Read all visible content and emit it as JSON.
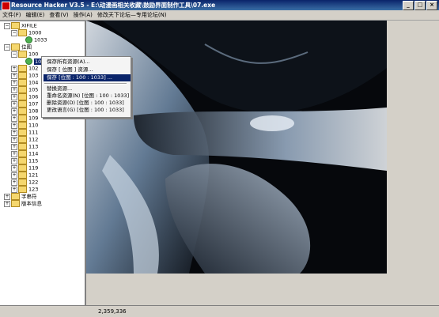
{
  "window": {
    "title": "Resource Hacker V3.5 - E:\\动漫画相关收藏\\鼓励界面制作工具\\07.exe",
    "min_icon": "minimize-icon",
    "max_icon": "maximize-icon",
    "close_icon": "close-icon"
  },
  "menubar": [
    "文件(F)",
    "编辑(E)",
    "查看(V)",
    "操作(A)",
    "修改天下论坛—专用论坛(N)"
  ],
  "tree": [
    {
      "label": "XIFILE",
      "expander": "−",
      "icon": "folder-icon"
    },
    {
      "label": "1000",
      "expander": "−",
      "icon": "folder-icon"
    },
    {
      "label": "1033",
      "expander": "",
      "icon": "gear-icon"
    },
    {
      "label": "位图",
      "expander": "−",
      "icon": "folder-icon"
    },
    {
      "label": "100",
      "expander": "−",
      "icon": "folder-icon"
    },
    {
      "label": "1033",
      "expander": "",
      "icon": "gear-icon",
      "selected": true
    },
    {
      "label": "102",
      "expander": "+",
      "icon": "folder-icon"
    },
    {
      "label": "103",
      "expander": "+",
      "icon": "folder-icon"
    },
    {
      "label": "104",
      "expander": "+",
      "icon": "folder-icon"
    },
    {
      "label": "105",
      "expander": "+",
      "icon": "folder-icon"
    },
    {
      "label": "106",
      "expander": "+",
      "icon": "folder-icon"
    },
    {
      "label": "107",
      "expander": "+",
      "icon": "folder-icon"
    },
    {
      "label": "108",
      "expander": "+",
      "icon": "folder-icon"
    },
    {
      "label": "109",
      "expander": "+",
      "icon": "folder-icon"
    },
    {
      "label": "110",
      "expander": "+",
      "icon": "folder-icon"
    },
    {
      "label": "111",
      "expander": "+",
      "icon": "folder-icon"
    },
    {
      "label": "112",
      "expander": "+",
      "icon": "folder-icon"
    },
    {
      "label": "113",
      "expander": "+",
      "icon": "folder-icon"
    },
    {
      "label": "114",
      "expander": "+",
      "icon": "folder-icon"
    },
    {
      "label": "115",
      "expander": "+",
      "icon": "folder-icon"
    },
    {
      "label": "119",
      "expander": "+",
      "icon": "folder-icon"
    },
    {
      "label": "121",
      "expander": "+",
      "icon": "folder-icon"
    },
    {
      "label": "122",
      "expander": "+",
      "icon": "folder-icon"
    },
    {
      "label": "123",
      "expander": "+",
      "icon": "folder-icon"
    },
    {
      "label": "字串符",
      "expander": "+",
      "icon": "folder-icon"
    },
    {
      "label": "版本信息",
      "expander": "+",
      "icon": "folder-icon"
    }
  ],
  "context_menu": [
    {
      "label": "保存所有资源(A)...",
      "highlighted": false
    },
    {
      "label": "保存 [ 位图 ] 资源...",
      "highlighted": false
    },
    {
      "label": "保存 [位图 : 100 : 1033] ...",
      "highlighted": true
    },
    {
      "label": "替换资源...",
      "highlighted": false
    },
    {
      "label": "重命名资源(N) [位图 : 100 : 1033]",
      "highlighted": false
    },
    {
      "label": "删除资源(D) [位图 : 100 : 1033]",
      "highlighted": false
    },
    {
      "label": "更改语言(G) [位图 : 100 : 1033]",
      "highlighted": false
    }
  ],
  "status": {
    "coords": "2,359,336"
  },
  "colors": {
    "titlebar": "#0a246a",
    "selection": "#0a246a",
    "window_bg": "#d4d0c8"
  }
}
